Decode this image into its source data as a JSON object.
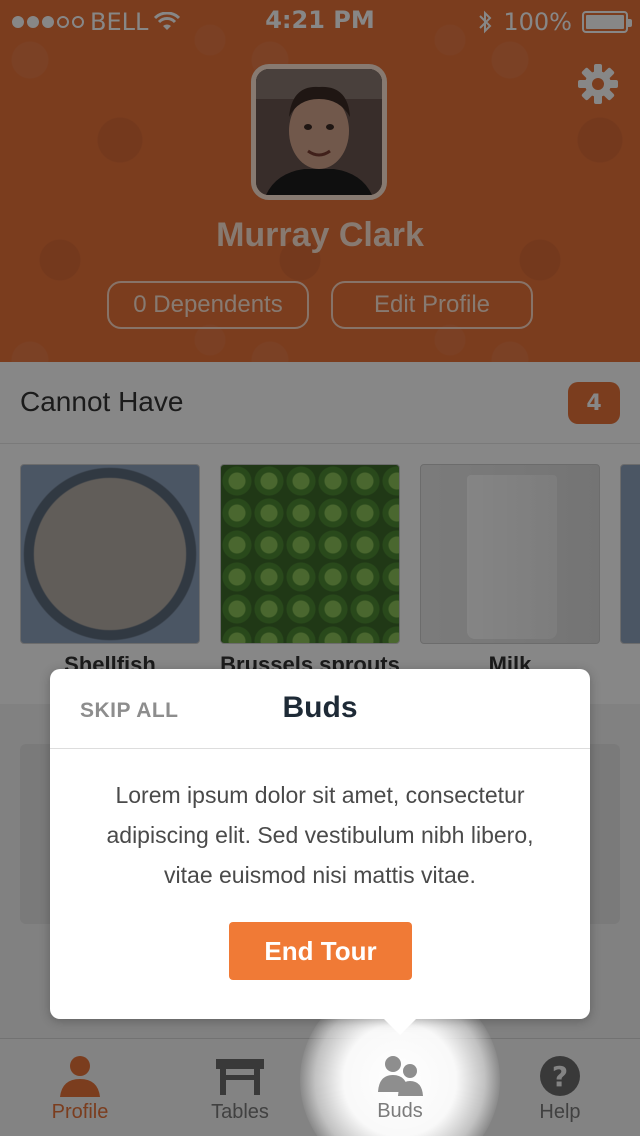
{
  "status_bar": {
    "carrier": "BELL",
    "time": "4:21 PM",
    "battery": "100%",
    "signal_bars_filled": 3,
    "signal_bars_total": 5
  },
  "profile": {
    "name": "Murray Clark",
    "dependents_label": "0 Dependents",
    "edit_label": "Edit Profile"
  },
  "cannot_have": {
    "title": "Cannot Have",
    "count": "4",
    "items": [
      {
        "label": "Shellfish"
      },
      {
        "label": "Brussels sprouts"
      },
      {
        "label": "Milk"
      }
    ]
  },
  "tour": {
    "skip_label": "SKIP ALL",
    "title": "Buds",
    "body": "Lorem ipsum dolor sit amet, consectetur adipiscing elit. Sed vestibulum nibh libero, vitae euismod nisi mattis vitae.",
    "button_label": "End Tour"
  },
  "tabs": [
    {
      "label": "Profile",
      "icon": "person-icon",
      "active": true
    },
    {
      "label": "Tables",
      "icon": "table-icon",
      "active": false
    },
    {
      "label": "Buds",
      "icon": "people-icon",
      "active": false
    },
    {
      "label": "Help",
      "icon": "question-icon",
      "active": false
    }
  ],
  "colors": {
    "accent": "#e8733a",
    "button": "#f07a36"
  }
}
